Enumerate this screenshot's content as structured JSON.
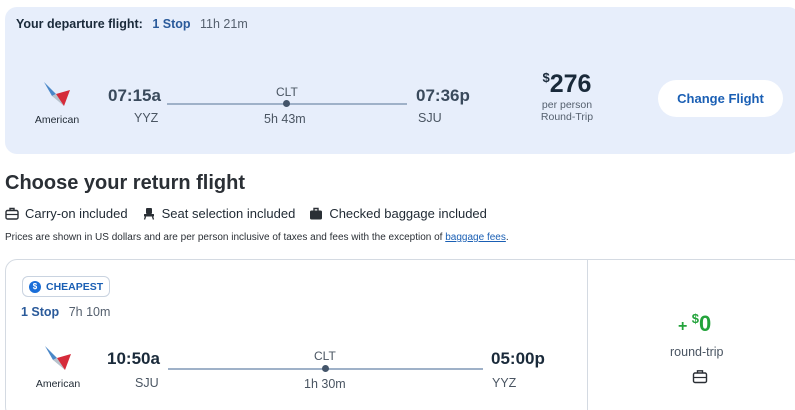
{
  "departure": {
    "label": "Your departure flight:",
    "stops": "1 Stop",
    "duration": "11h 21m",
    "airline": "American",
    "depart_time": "07:15a",
    "depart_code": "YYZ",
    "via": "CLT",
    "segment_duration": "5h 43m",
    "arrive_time": "07:36p",
    "arrive_code": "SJU",
    "price_currency": "$",
    "price_value": "276",
    "price_per": "per person",
    "price_type": "Round-Trip",
    "change_label": "Change Flight"
  },
  "return_section": {
    "heading": "Choose your return flight",
    "amenities": [
      {
        "icon": "carry-on-icon",
        "label": "Carry-on included"
      },
      {
        "icon": "seat-icon",
        "label": "Seat selection included"
      },
      {
        "icon": "checked-bag-icon",
        "label": "Checked baggage included"
      }
    ],
    "disclaimer_text": "Prices are shown in US dollars and are per person inclusive of taxes and fees with the exception of ",
    "disclaimer_link": "baggage fees",
    "disclaimer_end": "."
  },
  "return_flight": {
    "badge": "CHEAPEST",
    "stops": "1 Stop",
    "duration": "7h 10m",
    "airline": "American",
    "depart_time": "10:50a",
    "depart_code": "SJU",
    "via": "CLT",
    "segment_duration": "1h 30m",
    "arrive_time": "05:00p",
    "arrive_code": "YYZ",
    "add_plus": "+",
    "add_currency": "$",
    "add_value": "0",
    "price_label": "round-trip"
  },
  "colors": {
    "accent_blue": "#1a5fb4",
    "price_green": "#23a33b",
    "panel_bg": "#e7eefb"
  }
}
